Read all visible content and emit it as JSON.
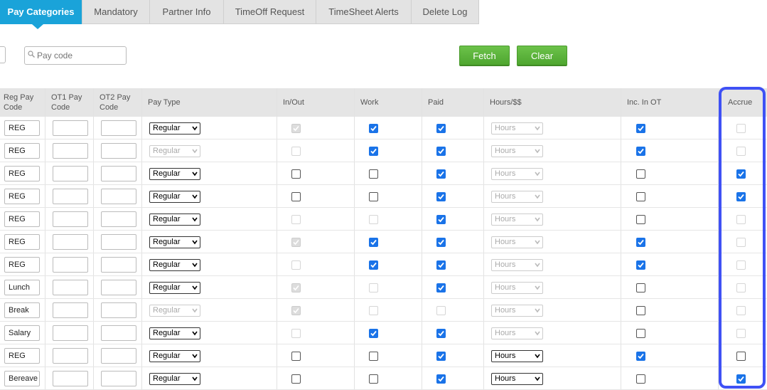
{
  "tabs": [
    {
      "label": "Pay Categories",
      "active": true
    },
    {
      "label": "Mandatory",
      "active": false
    },
    {
      "label": "Partner Info",
      "active": false
    },
    {
      "label": "TimeOff Request",
      "active": false
    },
    {
      "label": "TimeSheet Alerts",
      "active": false
    },
    {
      "label": "Delete Log",
      "active": false
    }
  ],
  "filters": {
    "pay_code_placeholder": "Pay code",
    "fetch_label": "Fetch",
    "clear_label": "Clear"
  },
  "table": {
    "columns": {
      "reg_pay_code": [
        "Reg Pay",
        "Code"
      ],
      "ot1_pay_code": [
        "OT1 Pay",
        "Code"
      ],
      "ot2_pay_code": [
        "OT2 Pay",
        "Code"
      ],
      "pay_type": "Pay Type",
      "in_out": "In/Out",
      "work": "Work",
      "paid": "Paid",
      "hours_dollars": "Hours/$$",
      "inc_in_ot": "Inc. In OT",
      "accrue": "Accrue"
    },
    "rows": [
      {
        "reg": "REG",
        "pay_type": "Regular",
        "pay_type_disabled": false,
        "in_out": "don",
        "work": "on",
        "paid": "on",
        "hours": "Hours",
        "hours_disabled": true,
        "inc_ot": "on",
        "accrue": "doff"
      },
      {
        "reg": "REG",
        "pay_type": "Regular",
        "pay_type_disabled": true,
        "in_out": "doff",
        "work": "on",
        "paid": "on",
        "hours": "Hours",
        "hours_disabled": true,
        "inc_ot": "on",
        "accrue": "doff"
      },
      {
        "reg": "REG",
        "pay_type": "Regular",
        "pay_type_disabled": false,
        "in_out": "off",
        "work": "off",
        "paid": "on",
        "hours": "Hours",
        "hours_disabled": true,
        "inc_ot": "off",
        "accrue": "on"
      },
      {
        "reg": "REG",
        "pay_type": "Regular",
        "pay_type_disabled": false,
        "in_out": "off",
        "work": "off",
        "paid": "on",
        "hours": "Hours",
        "hours_disabled": true,
        "inc_ot": "off",
        "accrue": "on"
      },
      {
        "reg": "REG",
        "pay_type": "Regular",
        "pay_type_disabled": false,
        "in_out": "doff",
        "work": "doff",
        "paid": "on",
        "hours": "Hours",
        "hours_disabled": true,
        "inc_ot": "off",
        "accrue": "doff"
      },
      {
        "reg": "REG",
        "pay_type": "Regular",
        "pay_type_disabled": false,
        "in_out": "don",
        "work": "on",
        "paid": "on",
        "hours": "Hours",
        "hours_disabled": true,
        "inc_ot": "on",
        "accrue": "doff"
      },
      {
        "reg": "REG",
        "pay_type": "Regular",
        "pay_type_disabled": false,
        "in_out": "doff",
        "work": "on",
        "paid": "on",
        "hours": "Hours",
        "hours_disabled": true,
        "inc_ot": "on",
        "accrue": "doff"
      },
      {
        "reg": "Lunch",
        "pay_type": "Regular",
        "pay_type_disabled": false,
        "in_out": "don",
        "work": "doff",
        "paid": "on",
        "hours": "Hours",
        "hours_disabled": true,
        "inc_ot": "off",
        "accrue": "doff"
      },
      {
        "reg": "Break",
        "pay_type": "Regular",
        "pay_type_disabled": true,
        "in_out": "don",
        "work": "doff",
        "paid": "doff",
        "hours": "Hours",
        "hours_disabled": true,
        "inc_ot": "off",
        "accrue": "doff"
      },
      {
        "reg": "Salary",
        "pay_type": "Regular",
        "pay_type_disabled": false,
        "in_out": "doff",
        "work": "on",
        "paid": "on",
        "hours": "Hours",
        "hours_disabled": true,
        "inc_ot": "off",
        "accrue": "doff"
      },
      {
        "reg": "REG",
        "pay_type": "Regular",
        "pay_type_disabled": false,
        "in_out": "off",
        "work": "off",
        "paid": "on",
        "hours": "Hours",
        "hours_disabled": false,
        "inc_ot": "on",
        "accrue": "off"
      },
      {
        "reg": "Bereave",
        "pay_type": "Regular",
        "pay_type_disabled": false,
        "in_out": "off",
        "work": "off",
        "paid": "on",
        "hours": "Hours",
        "hours_disabled": false,
        "inc_ot": "off",
        "accrue": "on"
      }
    ]
  },
  "colors": {
    "tab_active": "#1aa3d9",
    "button_green": "#5cb33b",
    "checkbox_blue": "#1a73e8",
    "highlight_border": "#3f51f5"
  }
}
